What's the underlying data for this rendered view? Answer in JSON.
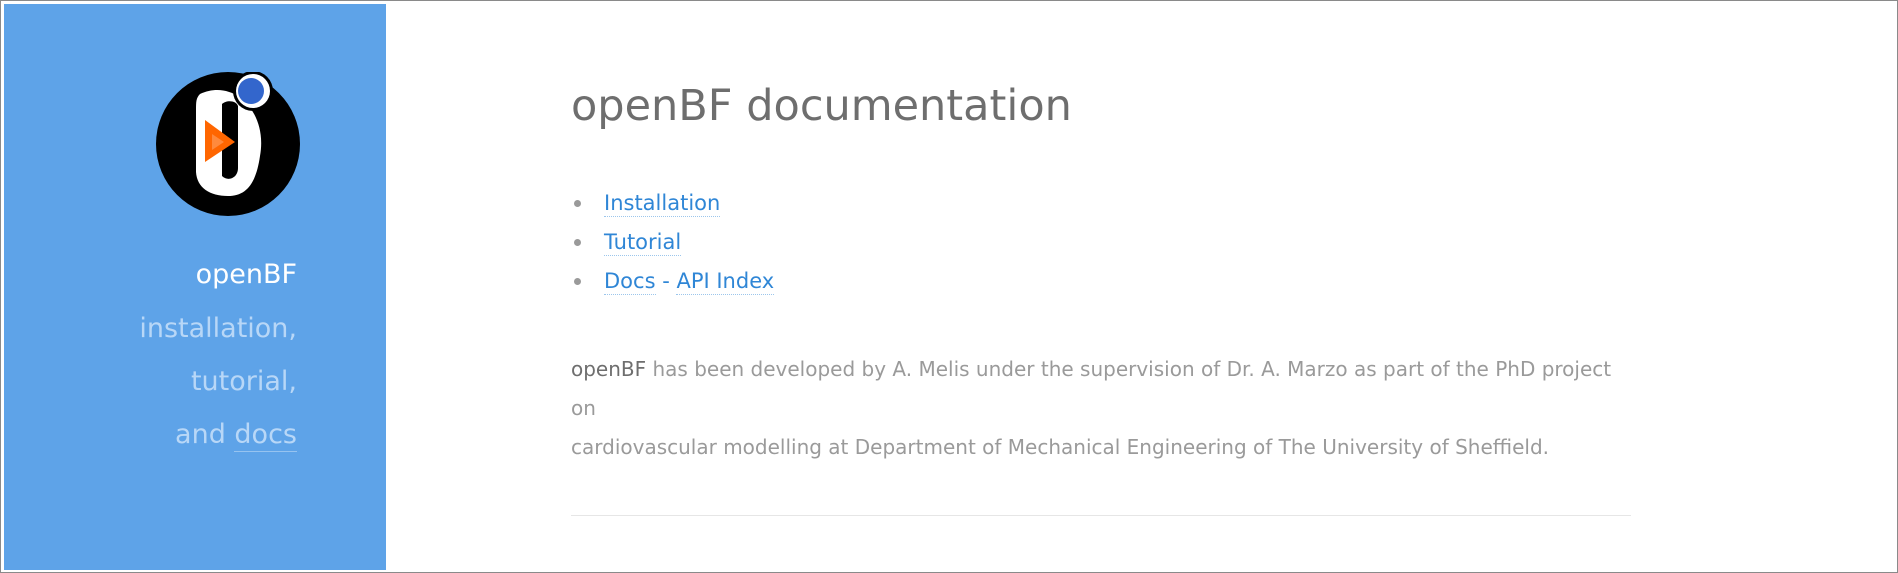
{
  "sidebar": {
    "logo_icon": "openbf-logo-icon",
    "title": "openBF",
    "line1": "installation,",
    "line2": "tutorial,",
    "line3_prefix": "and ",
    "line3_link": "docs"
  },
  "main": {
    "title": "openBF documentation",
    "toc": {
      "installation": "Installation",
      "tutorial": "Tutorial",
      "docs": "Docs",
      "separator": "-",
      "api_index": "API Index"
    },
    "description": {
      "project_name": "openBF",
      "sentence_part1": " has been developed by A. Melis under the supervision of Dr. A. Marzo as part of the PhD project on",
      "sentence_part2": "cardiovascular modelling at Department of Mechanical Engineering of The University of Sheffield."
    }
  },
  "colors": {
    "sidebar_bg": "#5ea3e8",
    "link": "#2f86d6",
    "title_text": "#6e6e6e",
    "body_text": "#9a9a9a",
    "logo_circle": "#000000",
    "logo_blob": "#ffffff",
    "logo_dot": "#3366cc",
    "logo_play": "#ff6600"
  }
}
